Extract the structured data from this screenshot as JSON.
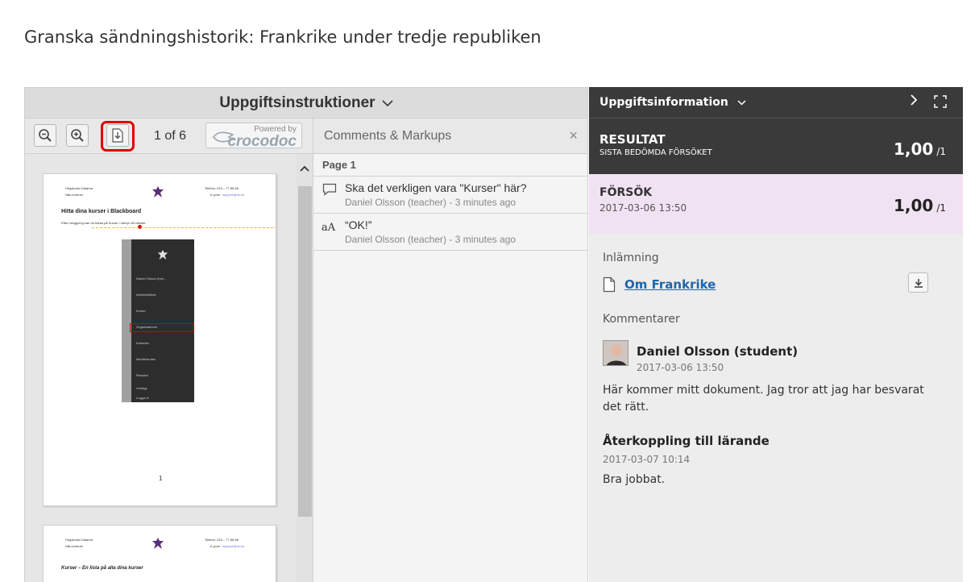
{
  "page": {
    "title": "Granska sändningshistorik: Frankrike under tredje republiken"
  },
  "viewer": {
    "header_title": "Uppgiftsinstruktioner",
    "toolbar": {
      "page_count": "1 of 6",
      "powered_by": "Powered by",
      "brand": "crocodoc"
    },
    "document": {
      "page1": {
        "header_left_1": "Högskolan Dalarna",
        "header_left_2": "Nät-centrum",
        "header_right_1": "Telefon: 023 – 77 88 88",
        "header_right_2": "E-post:",
        "header_right_email": "support@du.se",
        "heading": "Hitta dina kurser i Blackboard",
        "intro": "Efter inloggning kan du klicka på Kurser i menyn till vänster.",
        "menu_items": [
          "Daniel Olsson (Inst...",
          "Aktivitetsflöde",
          "Kurser",
          "Organisationer",
          "Kalender",
          "Meddelanden",
          "Resultat",
          "Verktyg",
          "Logga ut"
        ],
        "page_number": "1"
      },
      "page2": {
        "header_left_1": "Högskolan Dalarna",
        "header_left_2": "Nät-centrum",
        "header_right_1": "Telefon: 023 – 77 88 88",
        "header_right_2": "E-post:",
        "header_right_email": "support@du.se",
        "heading": "Kurser – En lista på alla dina kurser"
      }
    },
    "comments": {
      "title": "Comments & Markups",
      "close": "×",
      "page_label": "Page 1",
      "items": [
        {
          "text": "Ska det verkligen vara \"Kurser\" här?",
          "meta": "Daniel Olsson (teacher) - 3 minutes ago",
          "icon": "speech-bubble-icon"
        },
        {
          "text": "“OK!”",
          "meta": "Daniel Olsson (teacher) - 3 minutes ago",
          "icon": "text-annotation-icon",
          "icon_glyph": "aA"
        }
      ]
    }
  },
  "side": {
    "header_title": "Uppgiftsinformation",
    "resultat": {
      "label": "RESULTAT",
      "sublabel": "SISTA BEDÖMDA FÖRSÖKET",
      "score": "1,00",
      "max": "/1"
    },
    "forsok": {
      "label": "FÖRSÖK",
      "date": "2017-03-06 13:50",
      "score": "1,00",
      "max": "/1"
    },
    "submission": {
      "label": "Inlämning",
      "file_name": "Om Frankrike"
    },
    "comments": {
      "label": "Kommentarer",
      "author": "Daniel Olsson (student)",
      "date": "2017-03-06 13:50",
      "text": "Här kommer mitt dokument. Jag tror att jag har besvarat det rätt."
    },
    "feedback": {
      "title": "Återkoppling till lärande",
      "date": "2017-03-07 10:14",
      "text": "Bra jobbat."
    }
  },
  "colors": {
    "dark_panel": "#3a3a3a",
    "attempt_bg": "#f1e2f3",
    "link": "#2166a8",
    "highlight": "#e00000"
  }
}
